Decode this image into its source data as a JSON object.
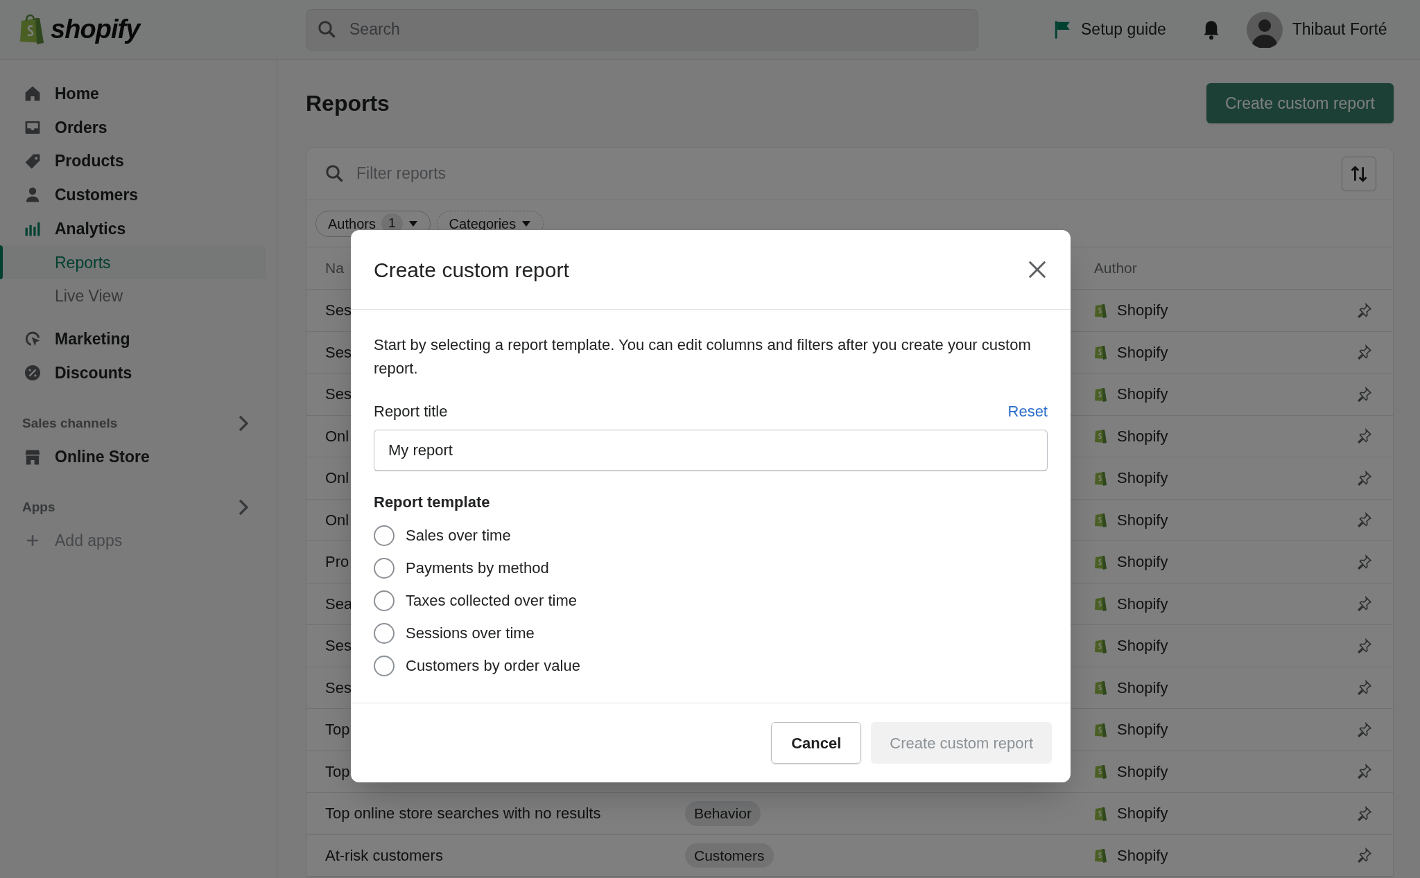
{
  "topbar": {
    "logo_text": "shopify",
    "search_placeholder": "Search",
    "setup_guide": "Setup guide",
    "user_name": "Thibaut Forté"
  },
  "sidebar": {
    "items": [
      {
        "label": "Home",
        "kind": "home",
        "selected": false
      },
      {
        "label": "Orders",
        "kind": "orders",
        "selected": false
      },
      {
        "label": "Products",
        "kind": "products",
        "selected": false
      },
      {
        "label": "Customers",
        "kind": "customers",
        "selected": false
      },
      {
        "label": "Analytics",
        "kind": "analytics",
        "selected": false
      },
      {
        "label": "Reports",
        "kind": "sub",
        "selected": true
      },
      {
        "label": "Live View",
        "kind": "sub",
        "selected": false
      },
      {
        "label": "Marketing",
        "kind": "marketing",
        "selected": false
      },
      {
        "label": "Discounts",
        "kind": "discounts",
        "selected": false
      }
    ],
    "sections": [
      {
        "title": "Sales channels",
        "items": [
          {
            "label": "Online Store",
            "kind": "store"
          }
        ]
      },
      {
        "title": "Apps",
        "items": [
          {
            "label": "Add apps",
            "kind": "add"
          }
        ]
      }
    ]
  },
  "page": {
    "title": "Reports",
    "primary_button": "Create custom report",
    "filter_placeholder": "Filter reports",
    "chips": [
      {
        "label": "Authors",
        "count": "1",
        "applied": true
      },
      {
        "label": "Categories",
        "applied": false
      }
    ],
    "table": {
      "columns": [
        "Na",
        "Author"
      ],
      "rows": [
        {
          "name": "Ses",
          "author": "Shopify"
        },
        {
          "name": "Ses",
          "author": "Shopify"
        },
        {
          "name": "Ses",
          "author": "Shopify"
        },
        {
          "name": "Onl",
          "author": "Shopify"
        },
        {
          "name": "Onl",
          "author": "Shopify"
        },
        {
          "name": "Onl",
          "author": "Shopify"
        },
        {
          "name": "Pro",
          "author": "Shopify"
        },
        {
          "name": "Sea",
          "author": "Shopify"
        },
        {
          "name": "Ses",
          "author": "Shopify"
        },
        {
          "name": "Ses",
          "author": "Shopify"
        },
        {
          "name": "Top",
          "author": "Shopify"
        },
        {
          "name": "Top",
          "author": "Shopify"
        },
        {
          "name": "Top online store searches with no results",
          "category": "Behavior",
          "author": "Shopify"
        },
        {
          "name": "At-risk customers",
          "category": "Customers",
          "author": "Shopify"
        }
      ]
    }
  },
  "modal": {
    "title": "Create custom report",
    "description": "Start by selecting a report template. You can edit columns and filters after you create your custom report.",
    "field_label": "Report title",
    "reset_link": "Reset",
    "field_value": "My report",
    "template_heading": "Report template",
    "options": [
      {
        "label": "Sales over time",
        "selected": false
      },
      {
        "label": "Payments by method",
        "selected": false
      },
      {
        "label": "Taxes collected over time",
        "selected": false
      },
      {
        "label": "Sessions over time",
        "selected": false
      },
      {
        "label": "Customers by order value",
        "selected": false
      }
    ],
    "cancel_button": "Cancel",
    "create_button": {
      "label": "Create custom report",
      "disabled": true
    }
  }
}
